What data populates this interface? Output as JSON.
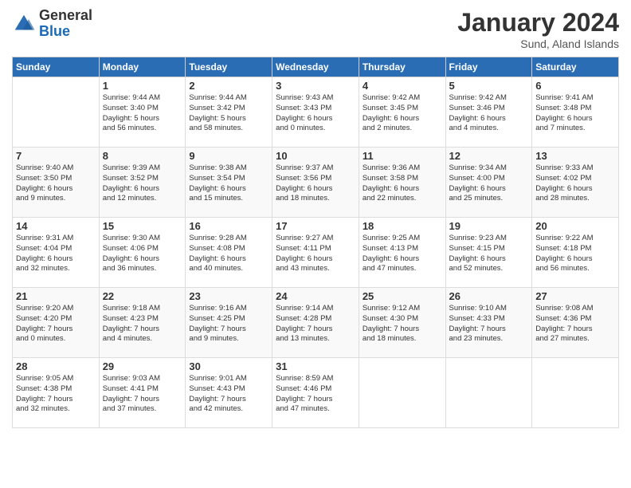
{
  "header": {
    "logo_general": "General",
    "logo_blue": "Blue",
    "month_title": "January 2024",
    "location": "Sund, Aland Islands"
  },
  "weekdays": [
    "Sunday",
    "Monday",
    "Tuesday",
    "Wednesday",
    "Thursday",
    "Friday",
    "Saturday"
  ],
  "weeks": [
    [
      {
        "day": "",
        "info": ""
      },
      {
        "day": "1",
        "info": "Sunrise: 9:44 AM\nSunset: 3:40 PM\nDaylight: 5 hours\nand 56 minutes."
      },
      {
        "day": "2",
        "info": "Sunrise: 9:44 AM\nSunset: 3:42 PM\nDaylight: 5 hours\nand 58 minutes."
      },
      {
        "day": "3",
        "info": "Sunrise: 9:43 AM\nSunset: 3:43 PM\nDaylight: 6 hours\nand 0 minutes."
      },
      {
        "day": "4",
        "info": "Sunrise: 9:42 AM\nSunset: 3:45 PM\nDaylight: 6 hours\nand 2 minutes."
      },
      {
        "day": "5",
        "info": "Sunrise: 9:42 AM\nSunset: 3:46 PM\nDaylight: 6 hours\nand 4 minutes."
      },
      {
        "day": "6",
        "info": "Sunrise: 9:41 AM\nSunset: 3:48 PM\nDaylight: 6 hours\nand 7 minutes."
      }
    ],
    [
      {
        "day": "7",
        "info": "Sunrise: 9:40 AM\nSunset: 3:50 PM\nDaylight: 6 hours\nand 9 minutes."
      },
      {
        "day": "8",
        "info": "Sunrise: 9:39 AM\nSunset: 3:52 PM\nDaylight: 6 hours\nand 12 minutes."
      },
      {
        "day": "9",
        "info": "Sunrise: 9:38 AM\nSunset: 3:54 PM\nDaylight: 6 hours\nand 15 minutes."
      },
      {
        "day": "10",
        "info": "Sunrise: 9:37 AM\nSunset: 3:56 PM\nDaylight: 6 hours\nand 18 minutes."
      },
      {
        "day": "11",
        "info": "Sunrise: 9:36 AM\nSunset: 3:58 PM\nDaylight: 6 hours\nand 22 minutes."
      },
      {
        "day": "12",
        "info": "Sunrise: 9:34 AM\nSunset: 4:00 PM\nDaylight: 6 hours\nand 25 minutes."
      },
      {
        "day": "13",
        "info": "Sunrise: 9:33 AM\nSunset: 4:02 PM\nDaylight: 6 hours\nand 28 minutes."
      }
    ],
    [
      {
        "day": "14",
        "info": "Sunrise: 9:31 AM\nSunset: 4:04 PM\nDaylight: 6 hours\nand 32 minutes."
      },
      {
        "day": "15",
        "info": "Sunrise: 9:30 AM\nSunset: 4:06 PM\nDaylight: 6 hours\nand 36 minutes."
      },
      {
        "day": "16",
        "info": "Sunrise: 9:28 AM\nSunset: 4:08 PM\nDaylight: 6 hours\nand 40 minutes."
      },
      {
        "day": "17",
        "info": "Sunrise: 9:27 AM\nSunset: 4:11 PM\nDaylight: 6 hours\nand 43 minutes."
      },
      {
        "day": "18",
        "info": "Sunrise: 9:25 AM\nSunset: 4:13 PM\nDaylight: 6 hours\nand 47 minutes."
      },
      {
        "day": "19",
        "info": "Sunrise: 9:23 AM\nSunset: 4:15 PM\nDaylight: 6 hours\nand 52 minutes."
      },
      {
        "day": "20",
        "info": "Sunrise: 9:22 AM\nSunset: 4:18 PM\nDaylight: 6 hours\nand 56 minutes."
      }
    ],
    [
      {
        "day": "21",
        "info": "Sunrise: 9:20 AM\nSunset: 4:20 PM\nDaylight: 7 hours\nand 0 minutes."
      },
      {
        "day": "22",
        "info": "Sunrise: 9:18 AM\nSunset: 4:23 PM\nDaylight: 7 hours\nand 4 minutes."
      },
      {
        "day": "23",
        "info": "Sunrise: 9:16 AM\nSunset: 4:25 PM\nDaylight: 7 hours\nand 9 minutes."
      },
      {
        "day": "24",
        "info": "Sunrise: 9:14 AM\nSunset: 4:28 PM\nDaylight: 7 hours\nand 13 minutes."
      },
      {
        "day": "25",
        "info": "Sunrise: 9:12 AM\nSunset: 4:30 PM\nDaylight: 7 hours\nand 18 minutes."
      },
      {
        "day": "26",
        "info": "Sunrise: 9:10 AM\nSunset: 4:33 PM\nDaylight: 7 hours\nand 23 minutes."
      },
      {
        "day": "27",
        "info": "Sunrise: 9:08 AM\nSunset: 4:36 PM\nDaylight: 7 hours\nand 27 minutes."
      }
    ],
    [
      {
        "day": "28",
        "info": "Sunrise: 9:05 AM\nSunset: 4:38 PM\nDaylight: 7 hours\nand 32 minutes."
      },
      {
        "day": "29",
        "info": "Sunrise: 9:03 AM\nSunset: 4:41 PM\nDaylight: 7 hours\nand 37 minutes."
      },
      {
        "day": "30",
        "info": "Sunrise: 9:01 AM\nSunset: 4:43 PM\nDaylight: 7 hours\nand 42 minutes."
      },
      {
        "day": "31",
        "info": "Sunrise: 8:59 AM\nSunset: 4:46 PM\nDaylight: 7 hours\nand 47 minutes."
      },
      {
        "day": "",
        "info": ""
      },
      {
        "day": "",
        "info": ""
      },
      {
        "day": "",
        "info": ""
      }
    ]
  ]
}
